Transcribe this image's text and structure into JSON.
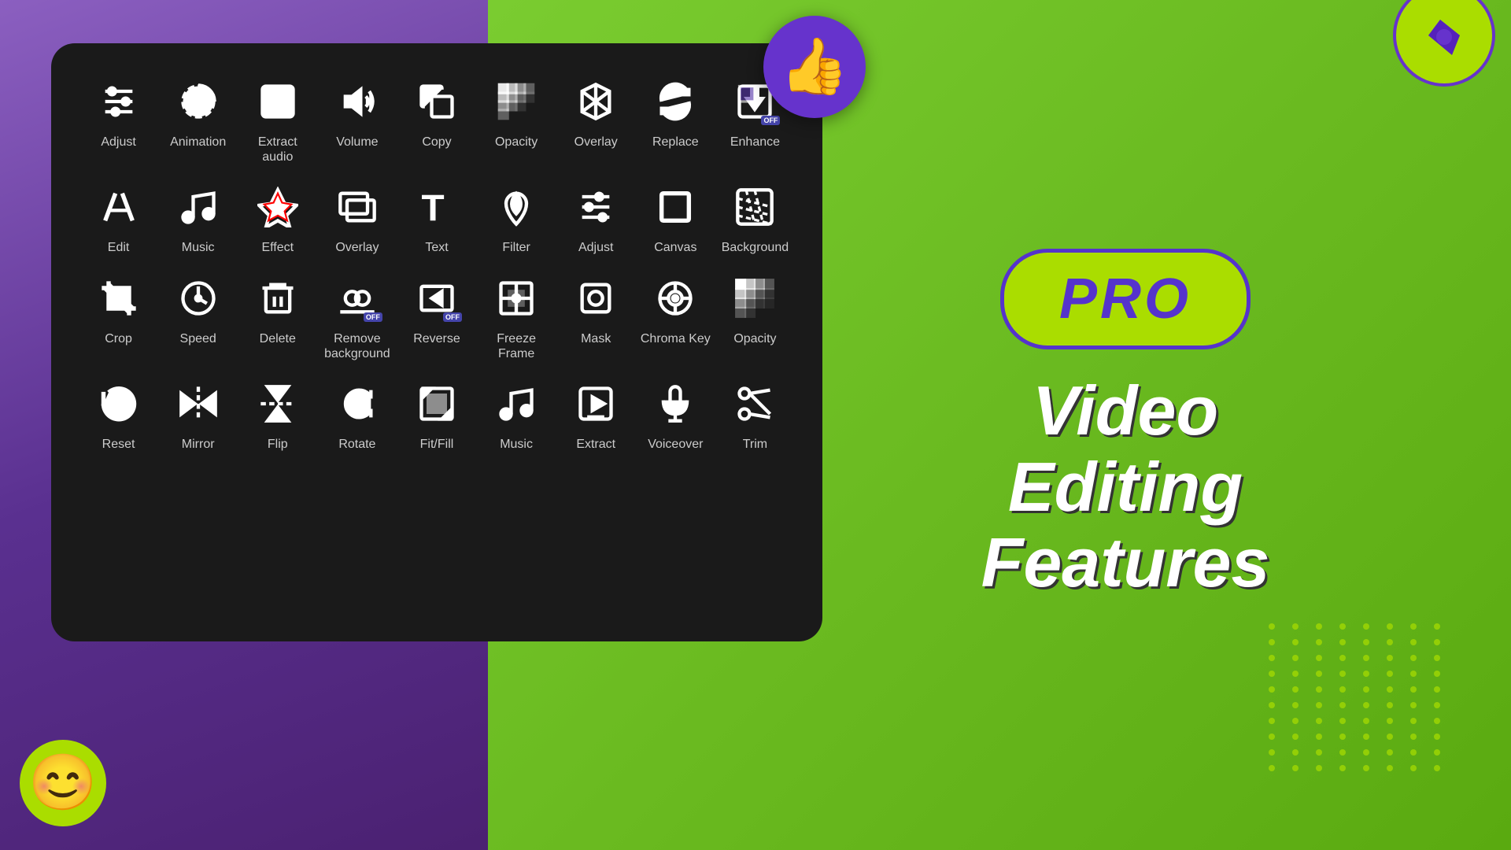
{
  "background": {
    "left_color": "#8b5fc0",
    "right_color": "#6aba20"
  },
  "panel": {
    "rows": [
      [
        {
          "id": "adjust",
          "label": "Adjust",
          "icon": "sliders"
        },
        {
          "id": "animation",
          "label": "Animation",
          "icon": "animation"
        },
        {
          "id": "extract-audio",
          "label": "Extract audio",
          "icon": "extract-audio"
        },
        {
          "id": "volume",
          "label": "Volume",
          "icon": "volume"
        },
        {
          "id": "copy",
          "label": "Copy",
          "icon": "copy"
        },
        {
          "id": "opacity",
          "label": "Opacity",
          "icon": "opacity"
        },
        {
          "id": "overlay",
          "label": "Overlay",
          "icon": "overlay"
        },
        {
          "id": "replace",
          "label": "Replace",
          "icon": "replace"
        },
        {
          "id": "enhance",
          "label": "Enhance",
          "icon": "enhance"
        }
      ],
      [
        {
          "id": "edit",
          "label": "Edit",
          "icon": "scissors"
        },
        {
          "id": "music",
          "label": "Music",
          "icon": "music-note"
        },
        {
          "id": "effect",
          "label": "Effect",
          "icon": "effect"
        },
        {
          "id": "overlay2",
          "label": "Overlay",
          "icon": "overlay2"
        },
        {
          "id": "text",
          "label": "Text",
          "icon": "text-t"
        },
        {
          "id": "filter",
          "label": "Filter",
          "icon": "filter"
        },
        {
          "id": "adjust2",
          "label": "Adjust",
          "icon": "sliders2"
        },
        {
          "id": "canvas",
          "label": "Canvas",
          "icon": "canvas"
        },
        {
          "id": "background",
          "label": "Background",
          "icon": "background"
        }
      ],
      [
        {
          "id": "crop",
          "label": "Crop",
          "icon": "crop"
        },
        {
          "id": "speed",
          "label": "Speed",
          "icon": "speed"
        },
        {
          "id": "delete",
          "label": "Delete",
          "icon": "trash"
        },
        {
          "id": "remove-bg",
          "label": "Remove\nbackground",
          "icon": "remove-bg"
        },
        {
          "id": "reverse",
          "label": "Reverse",
          "icon": "reverse"
        },
        {
          "id": "freeze-frame",
          "label": "Freeze Frame",
          "icon": "freeze-frame"
        },
        {
          "id": "mask",
          "label": "Mask",
          "icon": "mask"
        },
        {
          "id": "chroma-key",
          "label": "Chroma Key",
          "icon": "chroma-key"
        },
        {
          "id": "opacity2",
          "label": "Opacity",
          "icon": "opacity2"
        }
      ],
      [
        {
          "id": "reset",
          "label": "Reset",
          "icon": "reset"
        },
        {
          "id": "mirror",
          "label": "Mirror",
          "icon": "mirror"
        },
        {
          "id": "flip",
          "label": "Flip",
          "icon": "flip"
        },
        {
          "id": "rotate",
          "label": "Rotate",
          "icon": "rotate"
        },
        {
          "id": "fit-fill",
          "label": "Fit/Fill",
          "icon": "fit-fill"
        },
        {
          "id": "music2",
          "label": "Music",
          "icon": "music-note2"
        },
        {
          "id": "extract",
          "label": "Extract",
          "icon": "extract"
        },
        {
          "id": "voiceover",
          "label": "Voiceover",
          "icon": "voiceover"
        },
        {
          "id": "trim",
          "label": "Trim",
          "icon": "trim"
        }
      ]
    ]
  },
  "promo": {
    "pro_label": "PRO",
    "line1": "Video",
    "line2": "Editing",
    "line3": "Features"
  },
  "thumbs_up": "👍",
  "smiley": "😊"
}
